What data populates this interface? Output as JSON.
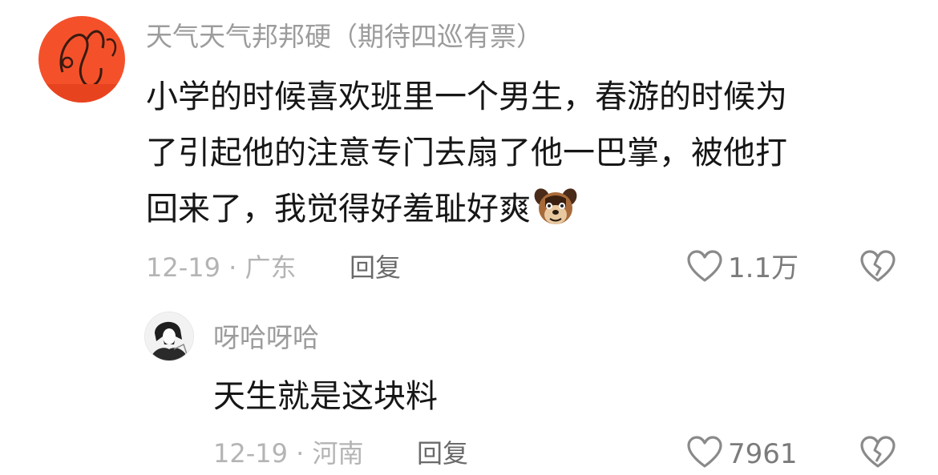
{
  "comments": [
    {
      "username": "天气天气邦邦硬（期待四巡有票）",
      "content_lines": [
        "小学的时候喜欢班里一个男生，春游的时候为",
        "了引起他的注意专门去扇了他一巴掌，被他打",
        "回来了，我觉得好羞耻好爽"
      ],
      "emoji": "dog-face-emoji",
      "date_location": "12-19 · 广东",
      "reply_label": "回复",
      "like_count": "1.1万",
      "avatar_color": "#f4512b"
    },
    {
      "username": "呀哈呀哈",
      "content_lines": [
        "天生就是这块料"
      ],
      "date_location": "12-19 · 河南",
      "reply_label": "回复",
      "like_count": "7961"
    }
  ],
  "colors": {
    "username": "#9c9c9c",
    "text": "#161616",
    "meta": "#b4b4b4",
    "reply": "#6a6a6a",
    "icon": "#8a8a8a"
  }
}
